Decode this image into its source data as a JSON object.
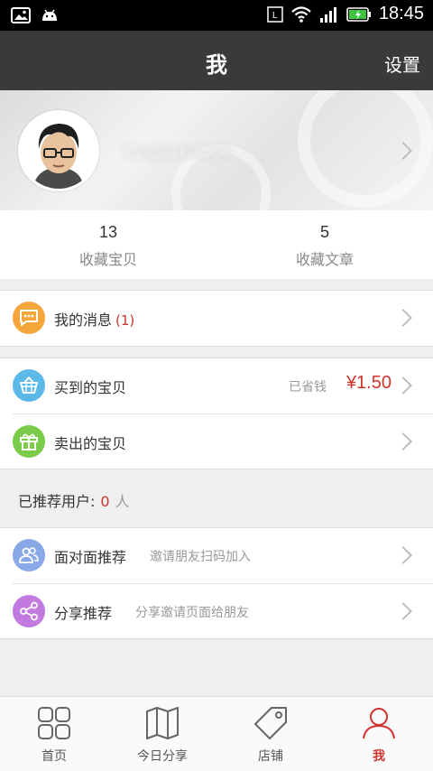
{
  "status_bar": {
    "time": "18:45"
  },
  "header": {
    "title": "我",
    "settings_label": "设置"
  },
  "profile": {
    "username": "Lingjiaxiaoge"
  },
  "stats": [
    {
      "count": "13",
      "label": "收藏宝贝"
    },
    {
      "count": "5",
      "label": "收藏文章"
    }
  ],
  "messages": {
    "label": "我的消息",
    "count": "(1)"
  },
  "orders": {
    "bought_label": "买到的宝贝",
    "saved_label": "已省钱",
    "saved_amount": "¥1.50",
    "sold_label": "卖出的宝贝"
  },
  "recommend": {
    "label": "已推荐用户:",
    "count": "0",
    "unit": "人"
  },
  "share": {
    "face_label": "面对面推荐",
    "face_sub": "邀请朋友扫码加入",
    "share_label": "分享推荐",
    "share_sub": "分享邀请页面给朋友"
  },
  "tabs": [
    {
      "label": "首页",
      "icon": "grid-icon"
    },
    {
      "label": "今日分享",
      "icon": "map-icon"
    },
    {
      "label": "店铺",
      "icon": "tag-icon"
    },
    {
      "label": "我",
      "icon": "person-icon"
    }
  ],
  "colors": {
    "accent": "#d0342c",
    "header_bg": "#3a3a3a",
    "message_icon": "#f5a63a",
    "bought_icon": "#5bb8e8",
    "sold_icon": "#7acb4a",
    "face_icon": "#8aa8e8",
    "share_icon": "#c27ae0"
  }
}
